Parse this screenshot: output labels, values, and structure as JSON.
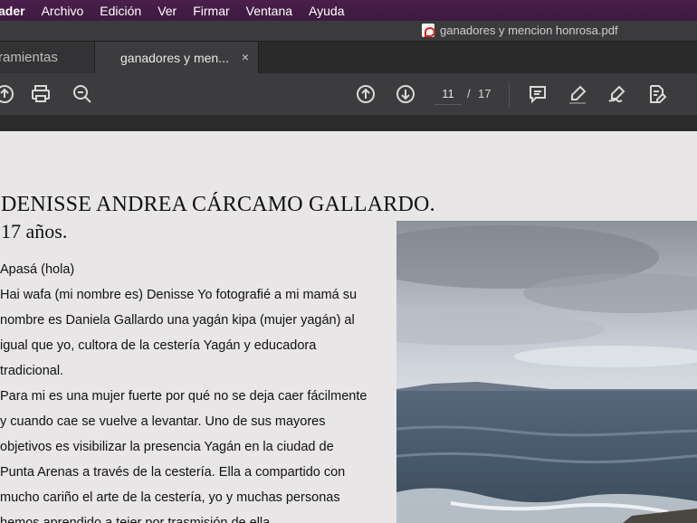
{
  "menubar": {
    "app_name": "ader",
    "items": [
      "Archivo",
      "Edición",
      "Ver",
      "Firmar",
      "Ventana",
      "Ayuda"
    ]
  },
  "window": {
    "title": "ganadores y mencion honrosa.pdf"
  },
  "tabs": {
    "tools_label": "ramientas",
    "doc_label": "ganadores y men...",
    "close_glyph": "×"
  },
  "toolbar": {
    "icons_left": [
      "upload-icon",
      "print-icon",
      "zoom-icon"
    ],
    "icons_nav": [
      "page-up-icon",
      "page-down-icon"
    ],
    "current_page": "11",
    "separator": "/",
    "total_pages": "17",
    "icons_right": [
      "comment-icon",
      "highlight-icon",
      "sign-icon",
      "edit-pdf-icon"
    ]
  },
  "document": {
    "heading": "DENISSE ANDREA CÁRCAMO GALLARDO.",
    "age": "17 años.",
    "lines": [
      "Apasá (hola)",
      "Hai wafa (mi nombre es) Denisse Yo fotografié a mi mamá su",
      "nombre es Daniela Gallardo una yagán kipa (mujer yagán) al",
      "igual que yo, cultora de la cestería Yagán y educadora",
      "tradicional.",
      "Para mi es una mujer fuerte por qué no se deja caer fácilmente",
      "y cuando cae se vuelve a levantar. Uno de sus mayores",
      "objetivos es visibilizar la presencia Yagán en la ciudad de",
      "Punta Arenas a través de la cestería. Ella a compartido con",
      "mucho cariño el arte de la cestería, yo y muchas personas",
      "hemos aprendido a tejer por trasmisión de ella."
    ]
  },
  "colors": {
    "menubar": "#3d1a40",
    "toolbar": "#3c3c3e",
    "page_bg": "#e9e6e7"
  }
}
